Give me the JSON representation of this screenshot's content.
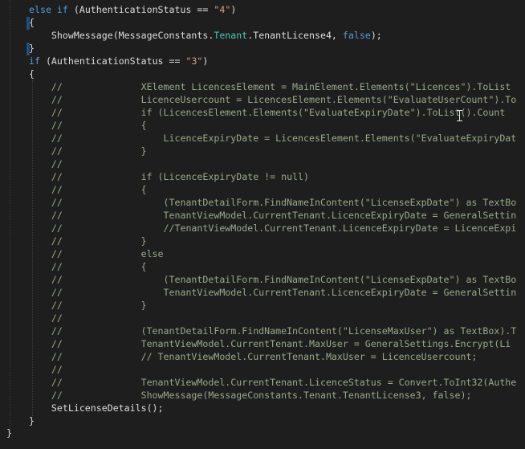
{
  "editor": {
    "lines": [
      [
        {
          "t": "else ",
          "c": "kw"
        },
        {
          "t": "if ",
          "c": "kw"
        },
        {
          "t": "(AuthenticationStatus == ",
          "c": "txt"
        },
        {
          "t": "\"4\"",
          "c": "str"
        },
        {
          "t": ")",
          "c": "txt"
        }
      ],
      [
        {
          "t": "{",
          "c": "txt"
        }
      ],
      [
        {
          "t": "    ShowMessage(MessageConstants.",
          "c": "txt"
        },
        {
          "t": "Tenant",
          "c": "type"
        },
        {
          "t": ".TenantLicense4, ",
          "c": "txt"
        },
        {
          "t": "false",
          "c": "kw"
        },
        {
          "t": ");",
          "c": "txt"
        }
      ],
      [
        {
          "t": "}",
          "c": "txt"
        }
      ],
      [
        {
          "t": "if ",
          "c": "kw"
        },
        {
          "t": "(AuthenticationStatus == ",
          "c": "txt"
        },
        {
          "t": "\"3\"",
          "c": "str"
        },
        {
          "t": ")",
          "c": "txt"
        }
      ],
      [
        {
          "t": "{",
          "c": "txt"
        }
      ],
      [
        {
          "t": "    //              XElement LicencesElement = MainElement.Elements(\"Licences\").ToList",
          "c": "cm"
        }
      ],
      [
        {
          "t": "    //              LicenceUsercount = LicencesElement.Elements(\"EvaluateUserCount\").To",
          "c": "cm"
        }
      ],
      [
        {
          "t": "    //              if (LicencesElement.Elements(\"EvaluateExpiryDate\").ToList().Count",
          "c": "cm"
        }
      ],
      [
        {
          "t": "    //              {",
          "c": "cm"
        }
      ],
      [
        {
          "t": "    //                  LicenceExpiryDate = LicencesElement.Elements(\"EvaluateExpiryDat",
          "c": "cm"
        }
      ],
      [
        {
          "t": "    //              }",
          "c": "cm"
        }
      ],
      [
        {
          "t": "    //",
          "c": "cm"
        }
      ],
      [
        {
          "t": "    //              if (LicenceExpiryDate != null)",
          "c": "cm"
        }
      ],
      [
        {
          "t": "    //              {",
          "c": "cm"
        }
      ],
      [
        {
          "t": "    //                  (TenantDetailForm.FindNameInContent(\"LicenseExpDate\") as TextBo",
          "c": "cm"
        }
      ],
      [
        {
          "t": "    //                  TenantViewModel.CurrentTenant.LicenceExpiryDate = GeneralSettin",
          "c": "cm"
        }
      ],
      [
        {
          "t": "    //                  //TenantViewModel.CurrentTenant.LicenceExpiryDate = LicenceExpi",
          "c": "cm"
        }
      ],
      [
        {
          "t": "    //              }",
          "c": "cm"
        }
      ],
      [
        {
          "t": "    //              else",
          "c": "cm"
        }
      ],
      [
        {
          "t": "    //              {",
          "c": "cm"
        }
      ],
      [
        {
          "t": "    //                  (TenantDetailForm.FindNameInContent(\"LicenseExpDate\") as TextBo",
          "c": "cm"
        }
      ],
      [
        {
          "t": "    //                  TenantViewModel.CurrentTenant.LicenceExpiryDate = GeneralSettin",
          "c": "cm"
        }
      ],
      [
        {
          "t": "    //              }",
          "c": "cm"
        }
      ],
      [
        {
          "t": "    //",
          "c": "cm"
        }
      ],
      [
        {
          "t": "    //              (TenantDetailForm.FindNameInContent(\"LicenseMaxUser\") as TextBox).T",
          "c": "cm"
        }
      ],
      [
        {
          "t": "    //              TenantViewModel.CurrentTenant.MaxUser = GeneralSettings.Encrypt(Li",
          "c": "cm"
        }
      ],
      [
        {
          "t": "    //              // TenantViewModel.CurrentTenant.MaxUser = LicenceUsercount;",
          "c": "cm"
        }
      ],
      [
        {
          "t": "    //",
          "c": "cm"
        }
      ],
      [
        {
          "t": "    //              TenantViewModel.CurrentTenant.LicenceStatus = Convert.ToInt32(Authe",
          "c": "cm"
        }
      ],
      [
        {
          "t": "    //              ShowMessage(MessageConstants.Tenant.TenantLicense3, false);",
          "c": "cm"
        }
      ],
      [
        {
          "t": "    SetLicenseDetails();",
          "c": "txt"
        }
      ],
      [
        {
          "t": "}",
          "c": "txt"
        }
      ]
    ],
    "indents": [
      4,
      4,
      4,
      4,
      0,
      0,
      0,
      0,
      0,
      0,
      0,
      0,
      0,
      0,
      0,
      0,
      0,
      0,
      0,
      0,
      0,
      0,
      0,
      0,
      0,
      0,
      0,
      0,
      0,
      0,
      0,
      0,
      0
    ],
    "trailing_brace": "}"
  }
}
